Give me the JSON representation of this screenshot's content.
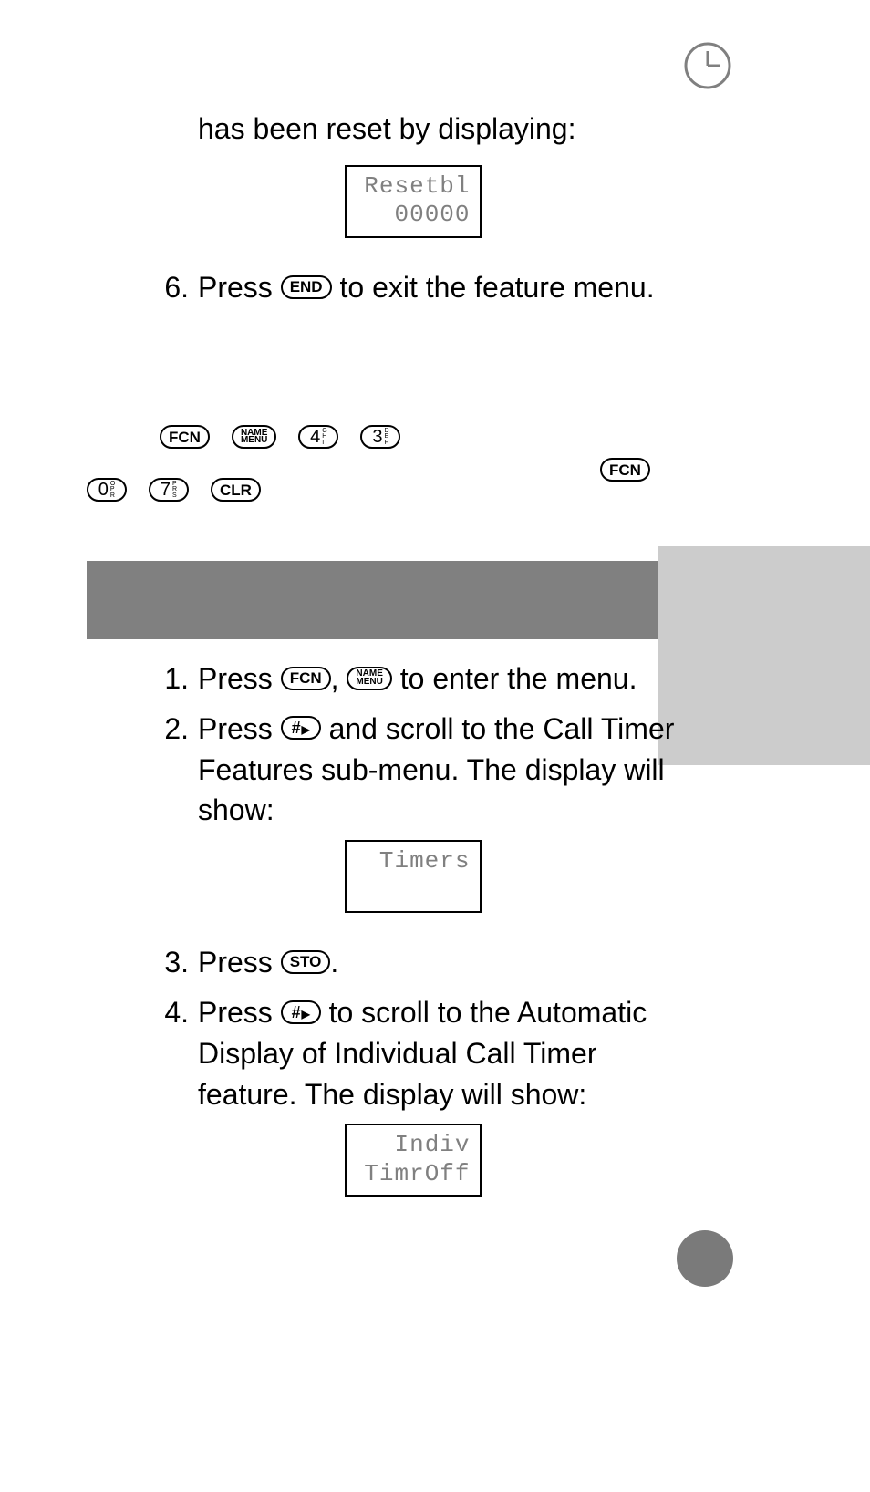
{
  "icons": {
    "clock": "clock-icon"
  },
  "intro_text": "has been reset by displaying:",
  "lcd1": {
    "line1": "Resetbl",
    "line2": "00000"
  },
  "step6": {
    "num": "6.",
    "before": "Press ",
    "key": "END",
    "after": " to exit the feature menu."
  },
  "keys": {
    "fcn": "FCN",
    "name": "NAME",
    "menu": "MENU",
    "four": "4",
    "four_sub": [
      "G",
      "H",
      "I"
    ],
    "three": "3",
    "three_sub": [
      "D",
      "E",
      "F"
    ],
    "zero": "0",
    "zero_sub": [
      "O",
      "P",
      "R"
    ],
    "seven": "7",
    "seven_sub": [
      "P",
      "R",
      "S"
    ],
    "clr": "CLR",
    "sto": "STO",
    "end": "END",
    "hash": "#"
  },
  "steps2": {
    "s1": {
      "num": "1.",
      "t1": "Press ",
      "t2": ", ",
      "t3": " to enter the menu."
    },
    "s2": {
      "num": "2.",
      "t1": "Press ",
      "t2": " and scroll to the Call Timer Features sub-menu. The display will show:"
    },
    "lcd2": {
      "line1": "Timers"
    },
    "s3": {
      "num": "3.",
      "t1": "Press ",
      "t2": "."
    },
    "s4": {
      "num": "4.",
      "t1": "Press ",
      "t2": " to scroll to the Automatic Display of Individual Call Timer feature. The display will show:"
    },
    "lcd3": {
      "line1": "Indiv",
      "line2": "TimrOff"
    }
  }
}
